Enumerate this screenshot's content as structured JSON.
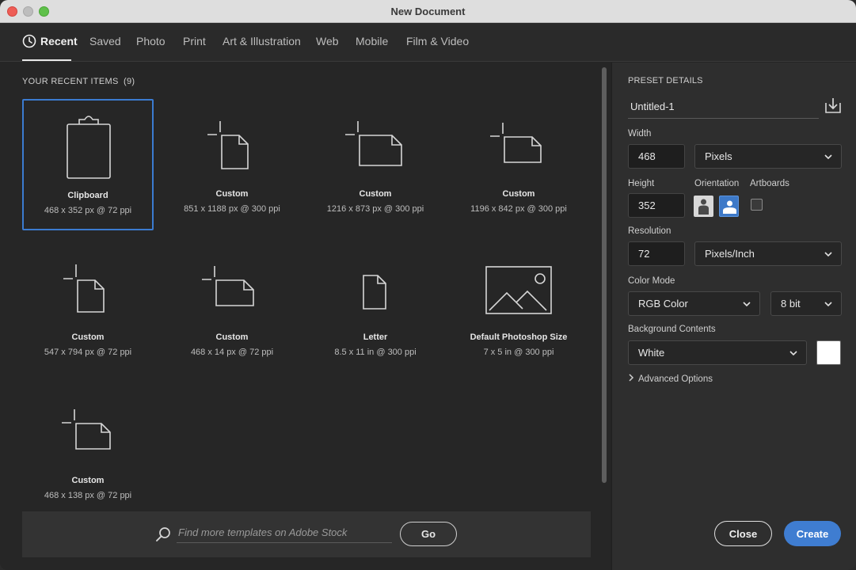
{
  "window": {
    "title": "New Document"
  },
  "tabs": [
    {
      "label": "Recent"
    },
    {
      "label": "Saved"
    },
    {
      "label": "Photo"
    },
    {
      "label": "Print"
    },
    {
      "label": "Art & Illustration"
    },
    {
      "label": "Web"
    },
    {
      "label": "Mobile"
    },
    {
      "label": "Film & Video"
    }
  ],
  "recent": {
    "title": "YOUR RECENT ITEMS",
    "count": "(9)",
    "items": [
      {
        "name": "Clipboard",
        "desc": "468 x 352 px @ 72 ppi",
        "icon": "clipboard-icon"
      },
      {
        "name": "Custom",
        "desc": "851 x 1188 px @ 300 ppi",
        "icon": "portrait-document-icon"
      },
      {
        "name": "Custom",
        "desc": "1216 x 873 px @ 300 ppi",
        "icon": "landscape-document-icon"
      },
      {
        "name": "Custom",
        "desc": "1196 x 842 px @ 300 ppi",
        "icon": "landscape-document-icon"
      },
      {
        "name": "Custom",
        "desc": "547 x 794 px @ 72 ppi",
        "icon": "portrait-document-icon"
      },
      {
        "name": "Custom",
        "desc": "468 x 14 px @ 72 ppi",
        "icon": "landscape-document-icon"
      },
      {
        "name": "Letter",
        "desc": "8.5 x 11 in @ 300 ppi",
        "icon": "letter-document-icon"
      },
      {
        "name": "Default Photoshop Size",
        "desc": "7 x 5 in @ 300 ppi",
        "icon": "photo-document-icon"
      },
      {
        "name": "Custom",
        "desc": "468 x 138 px @ 72 ppi",
        "icon": "landscape-document-icon"
      }
    ]
  },
  "stock": {
    "placeholder": "Find more templates on Adobe Stock",
    "go_label": "Go"
  },
  "preset": {
    "header": "PRESET DETAILS",
    "name": "Untitled-1",
    "width_label": "Width",
    "width_value": "468",
    "width_unit": "Pixels",
    "height_label": "Height",
    "height_value": "352",
    "orientation_label": "Orientation",
    "artboards_label": "Artboards",
    "resolution_label": "Resolution",
    "resolution_value": "72",
    "resolution_unit": "Pixels/Inch",
    "color_mode_label": "Color Mode",
    "color_mode": "RGB Color",
    "bit_depth": "8 bit",
    "background_label": "Background Contents",
    "background": "White",
    "background_color": "#ffffff",
    "advanced_label": "Advanced Options"
  },
  "actions": {
    "close_label": "Close",
    "create_label": "Create"
  },
  "colors": {
    "accent": "#3f7dd1",
    "selection": "#3b7bd0"
  }
}
